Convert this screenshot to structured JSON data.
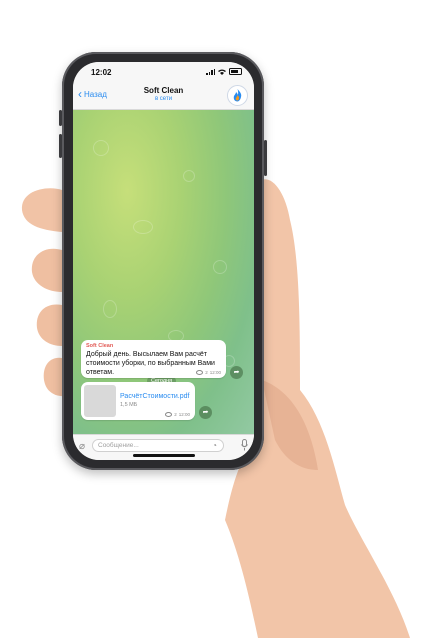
{
  "status": {
    "time": "12:02"
  },
  "header": {
    "back_label": "Назад",
    "title": "Soft Clean",
    "subtitle": "в сети"
  },
  "chat": {
    "date_divider": "Сегодня",
    "messages": [
      {
        "sender": "Soft Clean",
        "text": "Добрый день. Высылаем Вам расчёт стоимости уборки, по выбранным Вами ответам.",
        "views": "2",
        "time": "12:00"
      }
    ],
    "file": {
      "name": "РасчётСтоимости.pdf",
      "size": "1,5 МБ",
      "views": "2",
      "time": "12:00"
    }
  },
  "input": {
    "placeholder": "Сообщение..."
  },
  "icons": {
    "back": "chevron-left-icon",
    "attach": "paperclip-icon",
    "sticker": "sticker-icon",
    "mic": "microphone-icon",
    "share": "share-icon"
  },
  "colors": {
    "accent": "#2a8cf0",
    "sender": "#e25b57"
  }
}
